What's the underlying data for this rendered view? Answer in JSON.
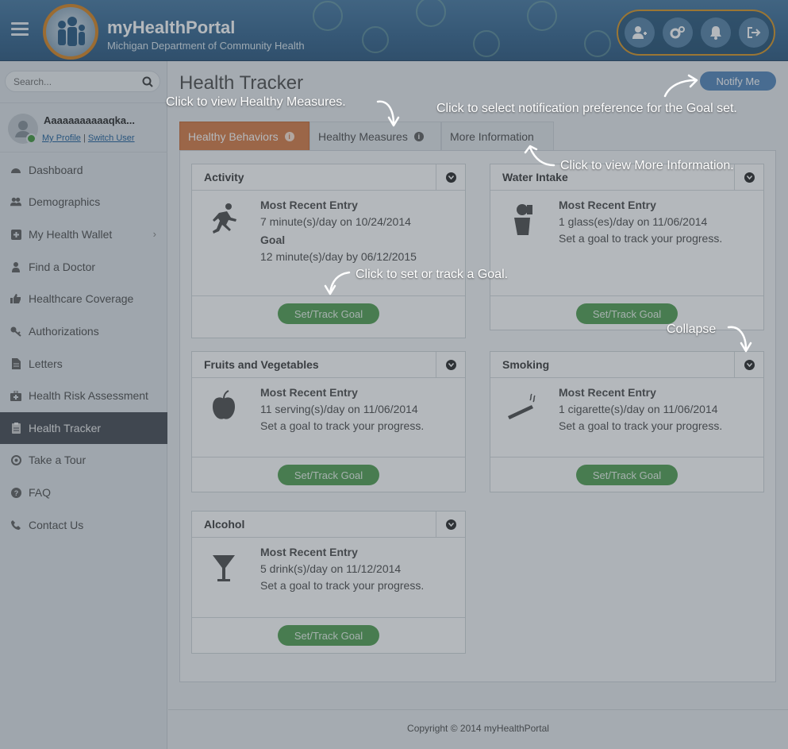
{
  "header": {
    "title": "myHealthPortal",
    "subtitle": "Michigan Department of Community Health",
    "actions": [
      "add-user-icon",
      "settings-icon",
      "bell-icon",
      "sign-out-icon"
    ]
  },
  "search": {
    "placeholder": "Search..."
  },
  "user": {
    "name": "Aaaaaaaaaaaqka...",
    "profile_link": "My Profile",
    "separator": "|",
    "switch_link": "Switch User"
  },
  "nav": [
    {
      "label": "Dashboard",
      "icon": "dashboard-icon"
    },
    {
      "label": "Demographics",
      "icon": "users-icon"
    },
    {
      "label": "My Health Wallet",
      "icon": "plus-square-icon",
      "chevron": "›"
    },
    {
      "label": "Find a Doctor",
      "icon": "doctor-icon"
    },
    {
      "label": "Healthcare Coverage",
      "icon": "thumbs-up-icon"
    },
    {
      "label": "Authorizations",
      "icon": "key-icon"
    },
    {
      "label": "Letters",
      "icon": "document-icon"
    },
    {
      "label": "Health Risk Assessment",
      "icon": "medkit-icon"
    },
    {
      "label": "Health Tracker",
      "icon": "clipboard-icon",
      "active": true
    },
    {
      "label": "Take a Tour",
      "icon": "compass-icon"
    },
    {
      "label": "FAQ",
      "icon": "question-icon"
    },
    {
      "label": "Contact Us",
      "icon": "phone-icon"
    }
  ],
  "main": {
    "title": "Health Tracker",
    "notify_label": "Notify Me",
    "tabs": [
      {
        "label": "Healthy Behaviors",
        "info": "i",
        "active": true
      },
      {
        "label": "Healthy Measures",
        "info": "i"
      },
      {
        "label": "More Information"
      }
    ],
    "cards": [
      {
        "title": "Activity",
        "icon": "running-icon",
        "mre_label": "Most Recent Entry",
        "mre_value": "7 minute(s)/day on 10/24/2014",
        "goal_label": "Goal",
        "goal_value": "12 minute(s)/day by 06/12/2015",
        "button": "Set/Track Goal"
      },
      {
        "title": "Water Intake",
        "icon": "drinking-icon",
        "mre_label": "Most Recent Entry",
        "mre_value": "1 glass(es)/day on 11/06/2014",
        "note": "Set a goal to track your progress.",
        "button": "Set/Track Goal"
      },
      {
        "title": "Fruits and Vegetables",
        "icon": "apple-icon",
        "mre_label": "Most Recent Entry",
        "mre_value": "11 serving(s)/day on 11/06/2014",
        "note": "Set a goal to track your progress.",
        "button": "Set/Track Goal"
      },
      {
        "title": "Smoking",
        "icon": "cigarette-icon",
        "mre_label": "Most Recent Entry",
        "mre_value": "1 cigarette(s)/day on 11/06/2014",
        "note": "Set a goal to track your progress.",
        "button": "Set/Track Goal"
      },
      {
        "title": "Alcohol",
        "icon": "martini-icon",
        "mre_label": "Most Recent Entry",
        "mre_value": "5 drink(s)/day on 11/12/2014",
        "note": "Set a goal to track your progress.",
        "button": "Set/Track Goal"
      }
    ]
  },
  "footer": {
    "copyright": "Copyright © 2014 myHealthPortal"
  },
  "tour_tips": {
    "healthy_measures": "Click to view Healthy Measures.",
    "notify": "Click to select notification preference for the Goal set.",
    "more_info": "Click to view More Information.",
    "set_goal": "Click to set or track a Goal.",
    "collapse": "Collapse"
  },
  "colors": {
    "header": "#3d6b93",
    "active_tab": "#d9824e",
    "goal_button": "#5aa45a",
    "notify_button": "#5a8bbd",
    "active_nav": "#4d5259"
  }
}
